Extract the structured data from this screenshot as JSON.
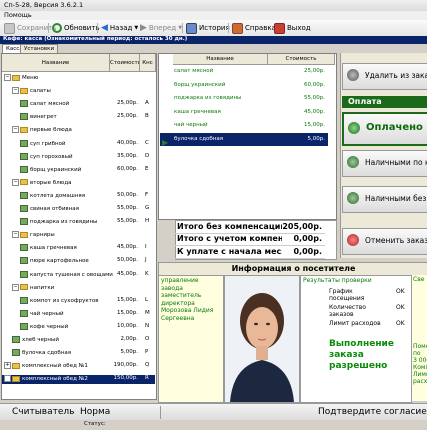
{
  "window": {
    "title": "Сп-5-28, Версия 3.6.2.1"
  },
  "menu": {
    "help": "Помощь"
  },
  "toolbar": {
    "save": "Сохранить",
    "refresh": "Обновить",
    "back": "Назад",
    "forward": "Вперед",
    "history": "История",
    "help": "Справка",
    "exit": "Выход"
  },
  "caption": "Кафе: касса (Ознакомительный период: осталось 30 дн.)",
  "tabs": [
    "Касса",
    "Установки"
  ],
  "menu_table": {
    "headers": {
      "name": "Название",
      "price": "Стоимость",
      "type": "Кнс"
    },
    "rows": [
      {
        "indent": 0,
        "kind": "root",
        "name": "Меню",
        "price": "",
        "type": ""
      },
      {
        "indent": 1,
        "kind": "folder",
        "name": "салаты",
        "price": "",
        "type": ""
      },
      {
        "indent": 2,
        "kind": "dish",
        "name": "салат мясной",
        "price": "25,00р.",
        "type": "A"
      },
      {
        "indent": 2,
        "kind": "dish",
        "name": "винегрет",
        "price": "25,00р.",
        "type": "B"
      },
      {
        "indent": 1,
        "kind": "folder",
        "name": "первые блюда",
        "price": "",
        "type": ""
      },
      {
        "indent": 2,
        "kind": "dish",
        "name": "суп грибной",
        "price": "40,00р.",
        "type": "C"
      },
      {
        "indent": 2,
        "kind": "dish",
        "name": "суп гороховый",
        "price": "35,00р.",
        "type": "D"
      },
      {
        "indent": 2,
        "kind": "dish",
        "name": "борщ украинский",
        "price": "60,00р.",
        "type": "E"
      },
      {
        "indent": 1,
        "kind": "folder",
        "name": "вторые блюда",
        "price": "",
        "type": ""
      },
      {
        "indent": 2,
        "kind": "dish",
        "name": "котлета домашняя",
        "price": "50,00р.",
        "type": "F"
      },
      {
        "indent": 2,
        "kind": "dish",
        "name": "свиная отбивная",
        "price": "55,00р.",
        "type": "G"
      },
      {
        "indent": 2,
        "kind": "dish",
        "name": "поджарка из говядины",
        "price": "55,00р.",
        "type": "H"
      },
      {
        "indent": 1,
        "kind": "folder",
        "name": "гарниры",
        "price": "",
        "type": ""
      },
      {
        "indent": 2,
        "kind": "dish",
        "name": "каша гречневая",
        "price": "45,00р.",
        "type": "I"
      },
      {
        "indent": 2,
        "kind": "dish",
        "name": "пюре картофельное",
        "price": "50,00р.",
        "type": "J"
      },
      {
        "indent": 2,
        "kind": "dish",
        "name": "капуста тушеная с овощами",
        "price": "45,00р.",
        "type": "K"
      },
      {
        "indent": 1,
        "kind": "folder",
        "name": "напитки",
        "price": "",
        "type": ""
      },
      {
        "indent": 2,
        "kind": "dish",
        "name": "компот из сухофруктов",
        "price": "15,00р.",
        "type": "L"
      },
      {
        "indent": 2,
        "kind": "dish",
        "name": "чай черный",
        "price": "15,00р.",
        "type": "M"
      },
      {
        "indent": 2,
        "kind": "dish",
        "name": "кофе черный",
        "price": "10,00р.",
        "type": "N"
      },
      {
        "indent": 1,
        "kind": "dish",
        "name": "хлеб черный",
        "price": "2,00р.",
        "type": "O"
      },
      {
        "indent": 1,
        "kind": "dish",
        "name": "булочка сдобная",
        "price": "5,00р.",
        "type": "P"
      },
      {
        "indent": 0,
        "kind": "folder",
        "name": "комплексный обед №1",
        "price": "190,00р.",
        "type": "Q"
      },
      {
        "indent": 0,
        "kind": "folder-sel",
        "name": "комплексный обед №2",
        "price": "150,00р.",
        "type": "R"
      }
    ]
  },
  "order": {
    "headers": {
      "name": "Название",
      "price": "Стоимость"
    },
    "items": [
      {
        "name": "салат мясной",
        "price": "25,00р."
      },
      {
        "name": "борщ украинский",
        "price": "60,00р."
      },
      {
        "name": "поджарка из говядины",
        "price": "55,00р."
      },
      {
        "name": "каша гречневая",
        "price": "45,00р."
      },
      {
        "name": "чай черный",
        "price": "15,00р."
      },
      {
        "name": "булочка сдобная",
        "price": "5,00р."
      }
    ],
    "selected_index": 5
  },
  "totals": [
    {
      "label": "Итого без компенсации",
      "value": "205,00р."
    },
    {
      "label": "Итого с учетом компенсации",
      "value": "0,00р."
    },
    {
      "label": "К уплате с начала месяца",
      "value": "0,00р."
    }
  ],
  "actions": {
    "delete": "Удалить из заказа",
    "payment_header": "Оплата",
    "paid": "Оплачено",
    "cash_print": "Наличными по кассе",
    "cash_no_print": "Наличными без кассы",
    "cancel": "Отменить заказ"
  },
  "visitor": {
    "header": "Информация о посетителе",
    "info": [
      "управление",
      "завода",
      "заместитель",
      "директора",
      "Морозова Лидия",
      "Сергеевна"
    ],
    "checks_header": "Результаты проверки",
    "checks": [
      {
        "label": "График посещения",
        "status": "OK"
      },
      {
        "label": "Количество заказов",
        "status": "OK"
      },
      {
        "label": "Лимит расходов",
        "status": "OK"
      }
    ],
    "result": "Выполнение заказа разрешено",
    "side_header": "Све",
    "side_lines": [
      "Поме",
      "по",
      "З 000",
      "Комп",
      "Лими",
      "расхо"
    ]
  },
  "statusbar": {
    "reader": "Считыватель",
    "norm": "Норма",
    "confirm": "Подтвердите согласие",
    "status": "Статус:"
  },
  "colors": {
    "caption": "#0a246a",
    "green_text": "#0a7a0a",
    "selected": "#0a246a"
  }
}
